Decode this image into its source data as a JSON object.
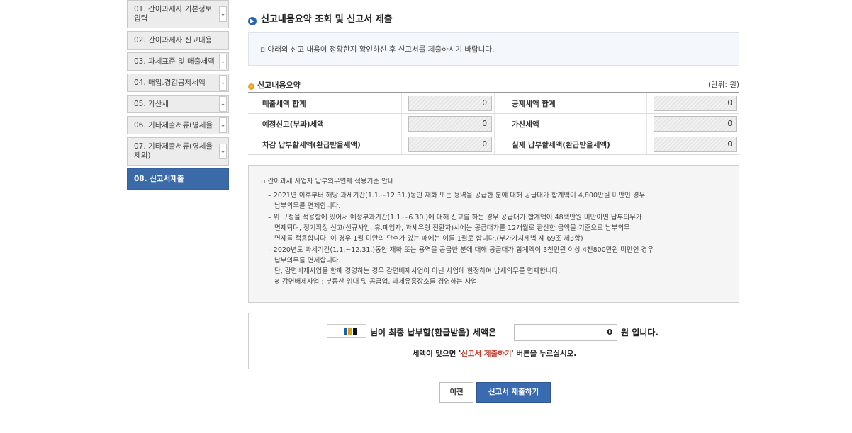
{
  "sidebar": {
    "items": [
      {
        "label": "01. 간이과세자 기본정보 입력"
      },
      {
        "label": "02. 간이과세자 신고내용"
      },
      {
        "label": "03. 과세표준 및 매출세액"
      },
      {
        "label": "04. 매입.경감공제세액"
      },
      {
        "label": "05. 가산세"
      },
      {
        "label": "06. 기타제출서류(영세율"
      },
      {
        "label": "07. 기타제출서류(영세율 제외)"
      },
      {
        "label": "08. 신고서제출"
      }
    ]
  },
  "main": {
    "title": "신고내용요약 조회 및 신고서 제출",
    "notice": "아래의 신고 내용이 정확한지 확인하신 후 신고서를 제출하시기 바랍니다.",
    "summary": {
      "title": "신고내용요약",
      "unit": "(단위: 원)",
      "rows": [
        {
          "label1": "매출세액 합계",
          "value1": "0",
          "label2": "공제세액 합계",
          "value2": "0"
        },
        {
          "label1": "예정신고(부과)세액",
          "value1": "0",
          "label2": "가산세액",
          "value2": "0"
        },
        {
          "label1": "차감 납부할세액(환급받을세액)",
          "value1": "0",
          "label2": "실제 납부할세액(환급받을세액)",
          "value2": "0"
        }
      ]
    },
    "guide": {
      "heading": "간이과세 사업자 납부의무면제 적용기준 안내",
      "items": [
        {
          "lines": [
            "2021년 이후부터 해당  과세기간(1.1.~12.31.)동안 재화 또는 용역을 공급한 분에 대해 공급대가 합계액이 4,800만원 미만인 경우",
            "납부의무를 면제합니다."
          ]
        },
        {
          "lines": [
            "위 규정을 적용함에 있어서 예정부과기간(1.1.~6.30.)에 대해 신고를 하는 경우 공급대가 합계액이 48백만원 미만이면 납부의무가",
            "면제되며, 정기확정 신고(신규사업, 휴.폐업자, 과세유형 전환자)시에는 공급대가를 12개월로 환산한 금액을 기준으로 납부의무",
            "면제를 적용합니다. 이 경우 1월 미만의 단수가 있는 때에는 이를 1월로 합니다.(부가가치세법 제 69조 제3항)"
          ]
        },
        {
          "lines": [
            "2020년도 과세기간(1.1.~12.31.)동안 재화 또는 용역을 공급한 분에 대해 공급대가 합계액이 3천만원 이상 4천800만원 미만인 경우",
            "납부의무를 면제합니다.",
            "단, 감면배제사업을 함께 경영하는 경우 감면배제사업이 아닌 사업에 한정하여 납세의무를 면제합니다.",
            " ※ 감면배제사업 : 부동산 임대 및 공급업, 과세유흥장소를 경영하는 사업"
          ]
        }
      ]
    },
    "final": {
      "text_before": "님이 최종 납부할(환급받을) 세액은",
      "amount": "0",
      "text_after": "원 입니다.",
      "hint_before": "세액이 맞으면 '",
      "hint_red": "신고서 제출하기",
      "hint_after": "' 버튼을 누르십시오."
    },
    "buttons": {
      "prev": "이전",
      "submit": "신고서 제출하기"
    }
  }
}
